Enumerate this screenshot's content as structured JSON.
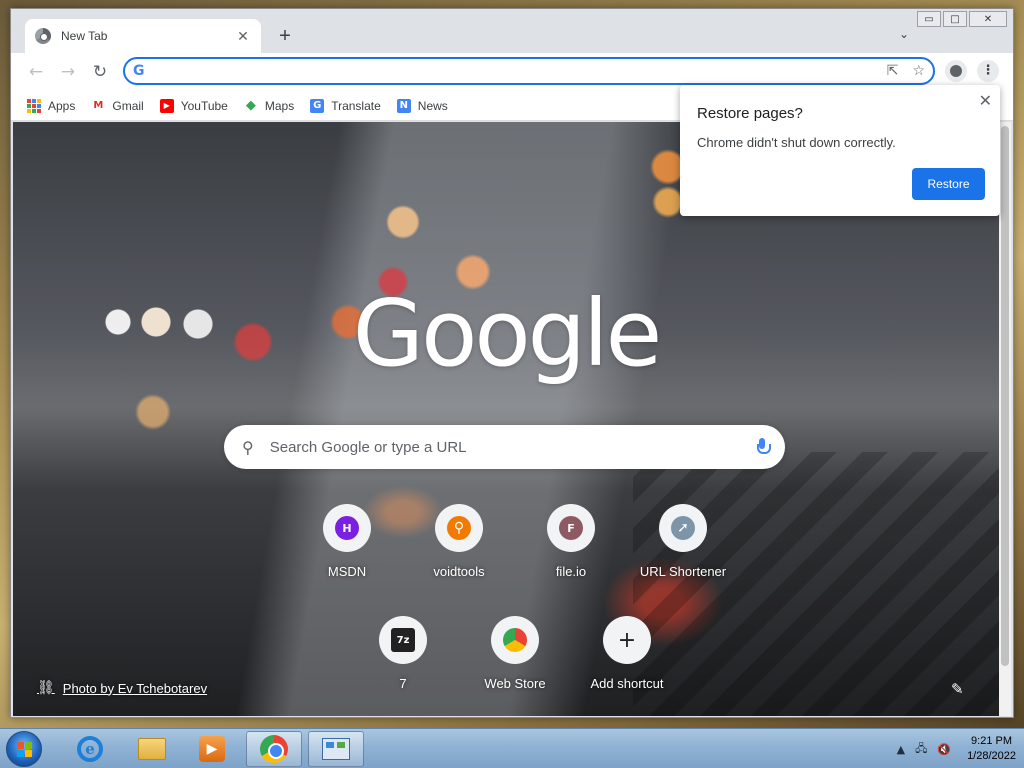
{
  "window": {
    "controls": {
      "minimize": "▭",
      "maximize": "□",
      "close": "✕"
    }
  },
  "tab": {
    "title": "New Tab",
    "close": "✕"
  },
  "tabstrip": {
    "new_tab": "+",
    "tab_search": "⌄"
  },
  "toolbar": {
    "back": "←",
    "forward": "→",
    "reload": "↻",
    "omnibox_value": "",
    "omnibox_g": "G",
    "share_icon": "⇱",
    "star_icon": "☆",
    "menu": "⋮"
  },
  "bookmarks": [
    {
      "label": "Apps",
      "icon": "apps-grid-icon"
    },
    {
      "label": "Gmail",
      "icon": "gmail-icon",
      "glyph": "M",
      "color": "#d93025"
    },
    {
      "label": "YouTube",
      "icon": "youtube-icon",
      "glyph": "▶",
      "color": "#ff0000"
    },
    {
      "label": "Maps",
      "icon": "maps-icon",
      "glyph": "◆",
      "color": "#34a853"
    },
    {
      "label": "Translate",
      "icon": "translate-icon",
      "glyph": "G",
      "color": "#4285f4"
    },
    {
      "label": "News",
      "icon": "news-icon",
      "glyph": "N",
      "color": "#4285f4"
    }
  ],
  "ntp": {
    "logo": "Google",
    "search_placeholder": "Search Google or type a URL",
    "search_icon": "⚲",
    "shortcuts": [
      {
        "label": "MSDN",
        "glyph": "H",
        "bg": "#7b1fe0",
        "icon": "msdn-favicon"
      },
      {
        "label": "voidtools",
        "glyph": "⚲",
        "bg": "#f07b00",
        "icon": "voidtools-favicon"
      },
      {
        "label": "file.io",
        "glyph": "F",
        "bg": "#8d5a63",
        "icon": "fileio-favicon"
      },
      {
        "label": "URL Shortener",
        "glyph": "➚",
        "bg": "#7c95a8",
        "icon": "url-shortener-favicon"
      },
      {
        "label": "7",
        "glyph": "7z",
        "bg": "#222222",
        "icon": "7zip-favicon"
      },
      {
        "label": "Web Store",
        "glyph": "◉",
        "bg": "#e04a3a",
        "icon": "webstore-favicon"
      },
      {
        "label": "Add shortcut",
        "glyph": "+",
        "bg": "transparent",
        "icon": "plus-icon"
      }
    ],
    "photo_credit": "Photo by Ev Tchebotarev",
    "link_icon": "⛓",
    "customize_icon": "✎"
  },
  "restore_popup": {
    "title": "Restore pages?",
    "body": "Chrome didn't shut down correctly.",
    "button": "Restore",
    "close": "✕"
  },
  "taskbar": {
    "clock_time": "9:21 PM",
    "clock_date": "1/28/2022",
    "tray_arrow": "▲",
    "tray_network": "🖧",
    "tray_volume": "🔇"
  },
  "colors": {
    "accent": "#1a73e8",
    "taskbar": "#8fb2d4"
  }
}
